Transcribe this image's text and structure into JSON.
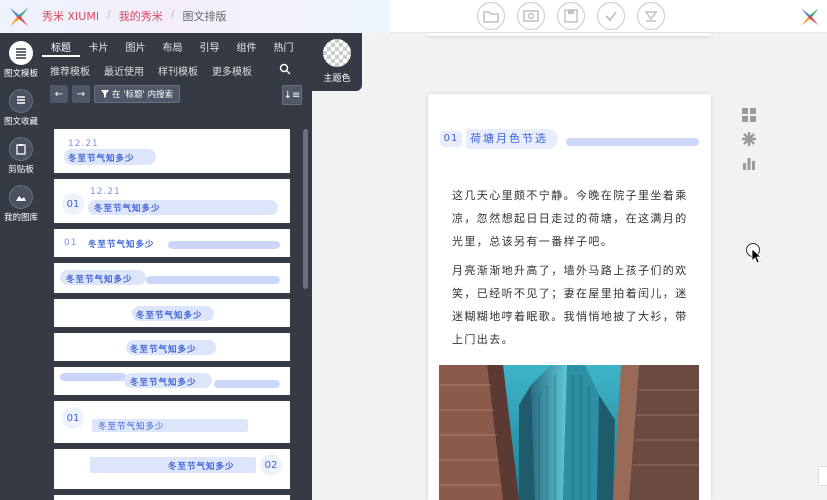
{
  "breadcrumb": {
    "brand": "秀米 XIUMI",
    "my": "我的秀米",
    "current": "图文排版",
    "sep": "/"
  },
  "rail": [
    {
      "label": "图文模板"
    },
    {
      "label": "图文收藏"
    },
    {
      "label": "剪贴板"
    },
    {
      "label": "我的图库"
    }
  ],
  "tabs": [
    "标题",
    "卡片",
    "图片",
    "布局",
    "引导",
    "组件",
    "热门"
  ],
  "subtabs": [
    "推荐模板",
    "最近使用",
    "样刊模板",
    "更多模板"
  ],
  "theme_label": "主题色",
  "search_filter": "在 '标题' 内搜索",
  "nav": {
    "prev": "←",
    "next": "→",
    "sort": "↓≡"
  },
  "templates": {
    "title_text": "冬至节气知多少",
    "date": "12.21",
    "n01": "01",
    "n02": "02"
  },
  "editor": {
    "num": "01",
    "title": "荷塘月色节选",
    "para1": "这几天心里颇不宁静。今晚在院子里坐着乘凉，忽然想起日日走过的荷塘，在这满月的光里，总该另有一番样子吧。",
    "para2": "月亮渐渐地升高了，墙外马路上孩子们的欢笑，已经听不见了；妻在屋里拍着闰儿，迷迷糊糊地哼着眠歌。我悄悄地披了大衫，带上门出去。"
  },
  "colors": {
    "accent": "#3e63d8",
    "panel": "#353a45",
    "brand": "#d8485c",
    "bar": "#c9d6f7"
  }
}
